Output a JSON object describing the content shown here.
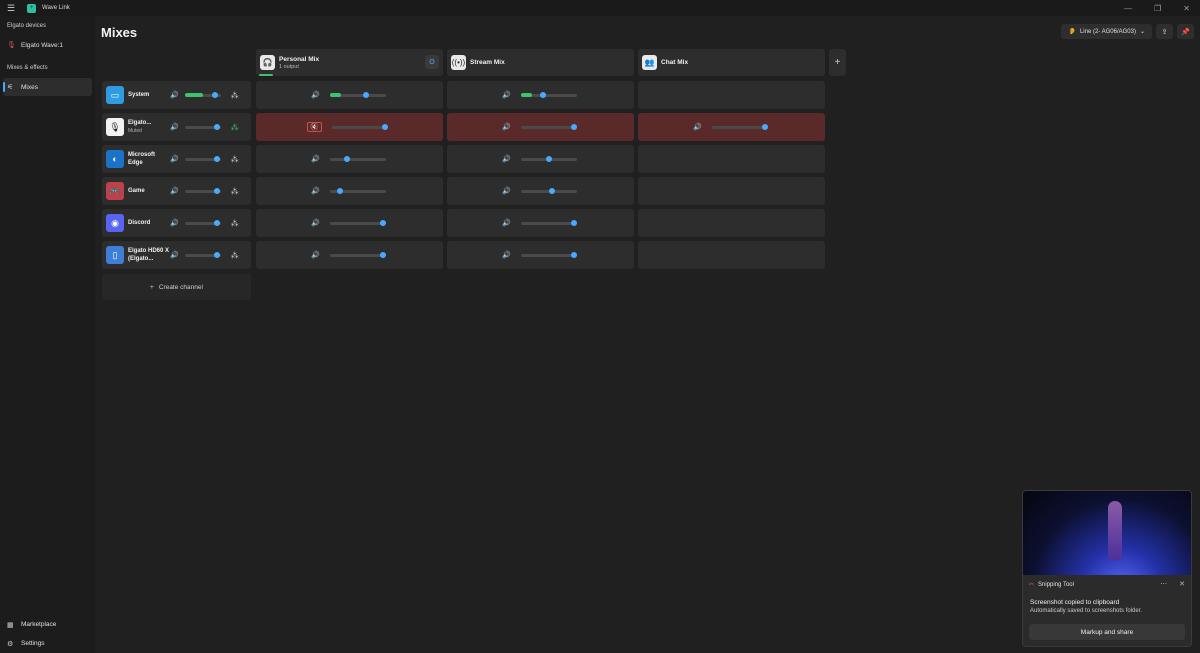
{
  "window": {
    "title": "Wave Link",
    "menu_icon": "hamburger-icon",
    "controls": [
      "minimize-icon",
      "maximize-icon",
      "close-icon"
    ]
  },
  "sidebar": {
    "devices_heading": "Elgato devices",
    "device_label": "Elgato Wave:1",
    "mixes_heading": "Mixes & effects",
    "mixes_item": "Mixes",
    "marketplace": "Marketplace",
    "settings": "Settings"
  },
  "header": {
    "title": "Mixes",
    "device_select": "Line (2- AG06/AG03)"
  },
  "mixes": [
    {
      "name": "Personal Mix",
      "sub": "1 output",
      "icon": "headphones-icon"
    },
    {
      "name": "Stream Mix",
      "sub": "",
      "icon": "broadcast-icon"
    },
    {
      "name": "Chat Mix",
      "sub": "",
      "icon": "people-icon"
    }
  ],
  "channels": [
    {
      "name": "System",
      "sub": "",
      "color": "#2f9be0",
      "icon": "monitor-icon",
      "master": 0.85,
      "level": 0.5,
      "personal": 0.65,
      "stream": 0.4,
      "chat": null
    },
    {
      "name": "Elgato...",
      "sub": "Muted",
      "color": "#f2f2f2",
      "icon": "microphone-icon",
      "master": 0.9,
      "level": 0,
      "personal": 0.95,
      "stream": 0.95,
      "chat": 0.95,
      "muted_personal": true
    },
    {
      "name": "Microsoft Edge",
      "sub": "",
      "color": "#1b73c7",
      "icon": "edge-icon",
      "master": 0.9,
      "level": 0,
      "personal": 0.3,
      "stream": 0.5,
      "chat": null
    },
    {
      "name": "Game",
      "sub": "",
      "color": "#c0404a",
      "icon": "gamepad-icon",
      "master": 0.9,
      "level": 0,
      "personal": 0.18,
      "stream": 0.55,
      "chat": null
    },
    {
      "name": "Discord",
      "sub": "",
      "color": "#5865f2",
      "icon": "discord-icon",
      "master": 0.9,
      "level": 0,
      "personal": 0.95,
      "stream": 0.95,
      "chat": null
    },
    {
      "name": "Elgato HD60 X (Elgato...",
      "sub": "",
      "color": "#3d7fd6",
      "icon": "capture-icon",
      "master": 0.9,
      "level": 0,
      "personal": 0.95,
      "stream": 0.95,
      "chat": null
    }
  ],
  "create_channel": "Create channel",
  "toast": {
    "app": "Snipping Tool",
    "message": "Screenshot copied to clipboard",
    "sub": "Automatically saved to screenshots folder.",
    "button": "Markup and share"
  }
}
